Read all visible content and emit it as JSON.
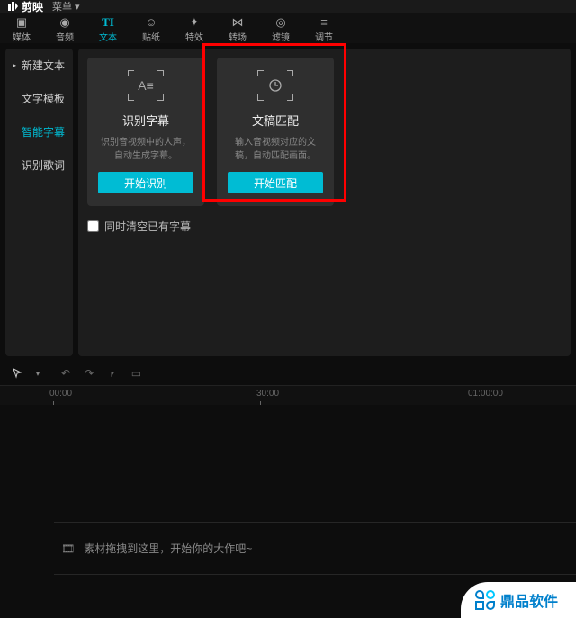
{
  "app": {
    "name": "剪映",
    "menu_label": "菜单"
  },
  "tabs": [
    {
      "label": "媒体",
      "icon": "media-icon"
    },
    {
      "label": "音频",
      "icon": "audio-icon"
    },
    {
      "label": "文本",
      "icon": "text-icon",
      "active": true
    },
    {
      "label": "贴纸",
      "icon": "sticker-icon"
    },
    {
      "label": "特效",
      "icon": "effects-icon"
    },
    {
      "label": "转场",
      "icon": "transition-icon"
    },
    {
      "label": "滤镜",
      "icon": "filter-icon"
    },
    {
      "label": "调节",
      "icon": "adjust-icon"
    }
  ],
  "sidebar": {
    "items": [
      {
        "label": "新建文本"
      },
      {
        "label": "文字模板"
      },
      {
        "label": "智能字幕",
        "active": true
      },
      {
        "label": "识别歌词"
      }
    ]
  },
  "cards": [
    {
      "id": "auto-subtitle",
      "title": "识别字幕",
      "desc": "识别音视频中的人声，自动生成字幕。",
      "button": "开始识别",
      "icon": "text-brackets-icon"
    },
    {
      "id": "script-match",
      "title": "文稿匹配",
      "desc": "输入音视频对应的文稿，自动匹配画面。",
      "button": "开始匹配",
      "icon": "clock-brackets-icon",
      "highlighted": true
    }
  ],
  "checkbox": {
    "label": "同时清空已有字幕"
  },
  "timeline": {
    "marks": [
      "00:00",
      "30:00",
      "01:00:00"
    ],
    "track_placeholder": "素材拖拽到这里，开始你的大作吧~"
  },
  "watermark": {
    "text": "鼎品软件"
  }
}
